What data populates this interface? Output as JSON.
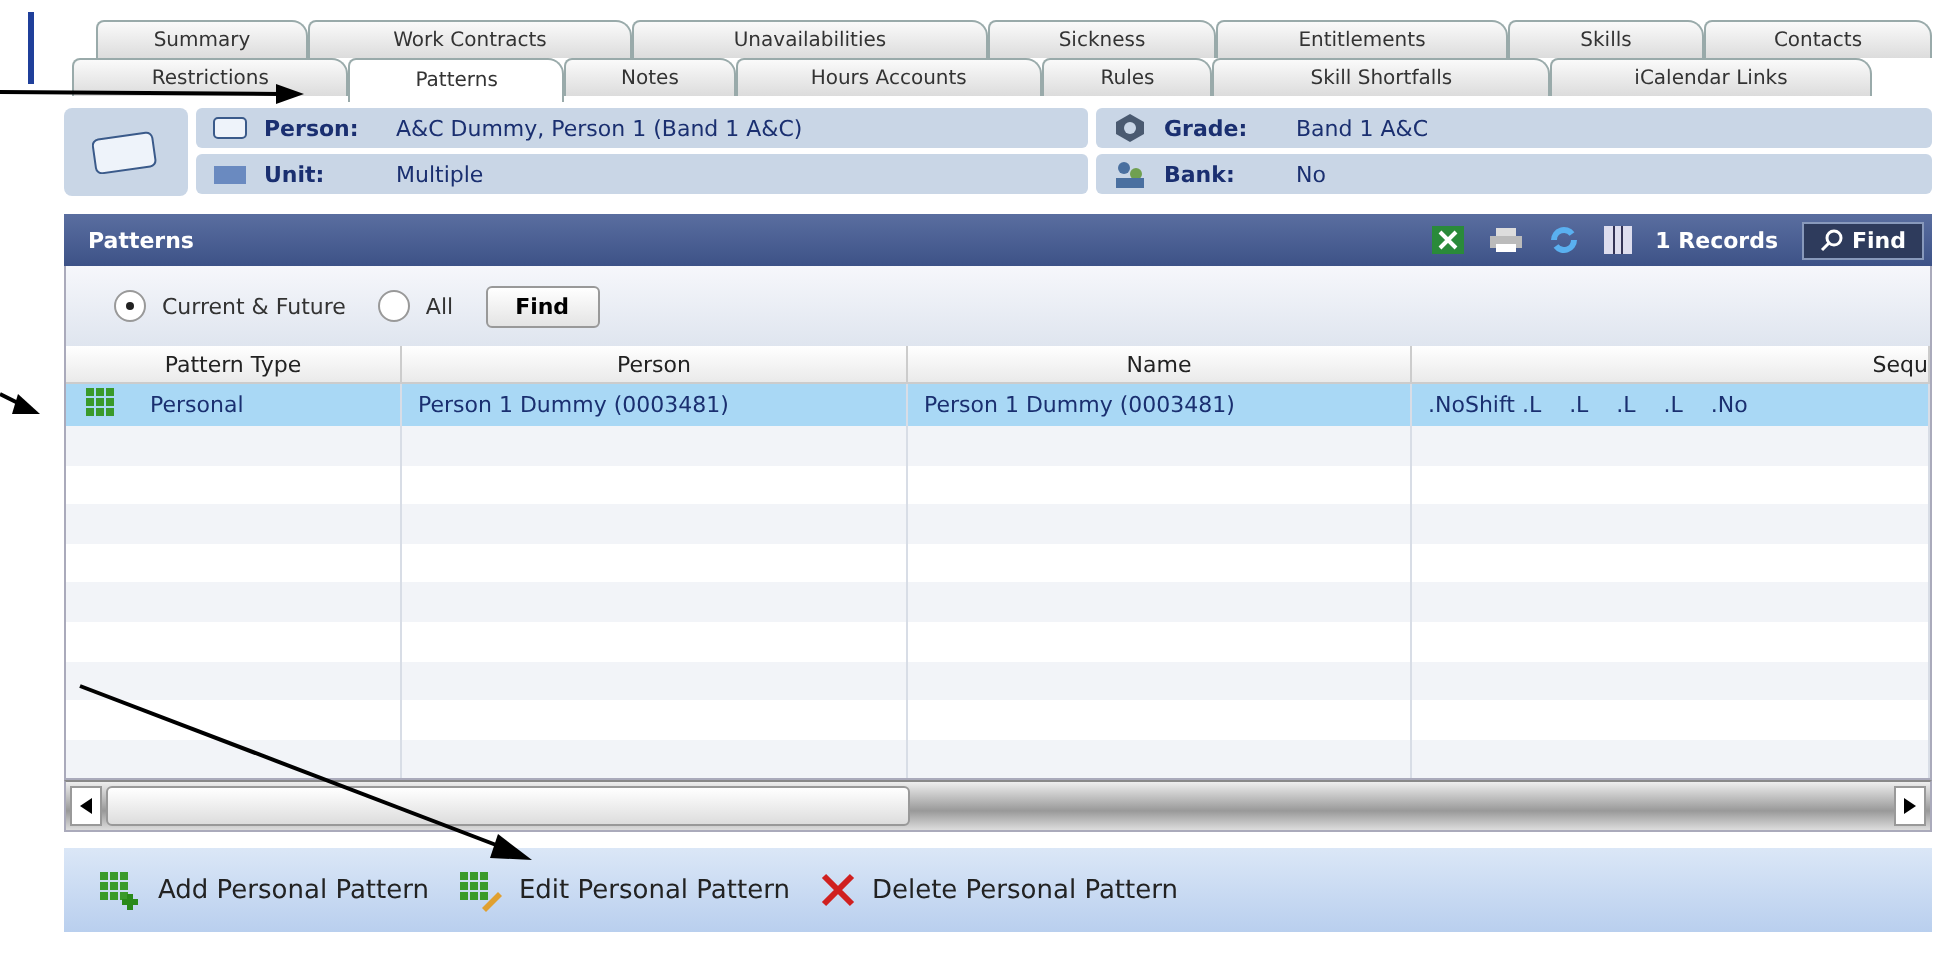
{
  "tabs_row_1": [
    {
      "label": "Summary",
      "selected": false
    },
    {
      "label": "Work Contracts",
      "selected": false
    },
    {
      "label": "Unavailabilities",
      "selected": false
    },
    {
      "label": "Sickness",
      "selected": false
    },
    {
      "label": "Entitlements",
      "selected": false
    },
    {
      "label": "Skills",
      "selected": false
    },
    {
      "label": "Contacts",
      "selected": false
    }
  ],
  "tabs_row_2": [
    {
      "label": "Restrictions",
      "selected": false
    },
    {
      "label": "Patterns",
      "selected": true
    },
    {
      "label": "Notes",
      "selected": false
    },
    {
      "label": "Hours Accounts",
      "selected": false
    },
    {
      "label": "Rules",
      "selected": false
    },
    {
      "label": "Skill Shortfalls",
      "selected": false
    },
    {
      "label": "iCalendar Links",
      "selected": false
    }
  ],
  "info": {
    "person_label": "Person:",
    "person": "A&C Dummy, Person 1 (Band 1 A&C)",
    "grade_label": "Grade:",
    "grade": "Band 1 A&C",
    "unit_label": "Unit:",
    "unit": "Multiple",
    "bank_label": "Bank:",
    "bank": "No"
  },
  "panel": {
    "title": "Patterns",
    "records": "1 Records",
    "find": "Find"
  },
  "filter": {
    "options": [
      {
        "label": "Current & Future",
        "selected": true
      },
      {
        "label": "All",
        "selected": false
      }
    ],
    "button": "Find"
  },
  "table": {
    "columns": [
      "Pattern Type",
      "Person",
      "Name",
      "Sequ"
    ],
    "rows": [
      {
        "selected": true,
        "cells": [
          "Personal",
          "Person 1 Dummy (0003481)",
          "Person 1 Dummy (0003481)",
          ".NoShift .L    .L    .L    .L    .No"
        ]
      }
    ]
  },
  "actions": [
    {
      "kind": "add",
      "label": "Add Personal Pattern"
    },
    {
      "kind": "edit",
      "label": "Edit Personal Pattern"
    },
    {
      "kind": "delete",
      "label": "Delete Personal Pattern"
    }
  ]
}
